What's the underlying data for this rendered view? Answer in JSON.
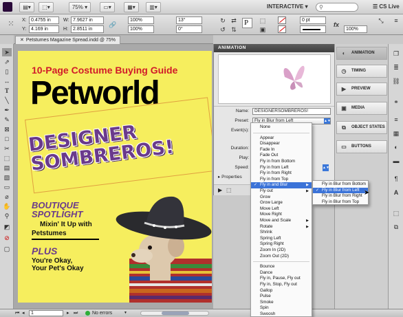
{
  "app": {
    "zoom": "75%",
    "workspace": "INTERACTIVE",
    "cs_live": "CS Live"
  },
  "control": {
    "x_label": "X:",
    "x_value": "0.4755 in",
    "y_label": "Y:",
    "y_value": "4.169 in",
    "w_label": "W:",
    "w_value": "7.9627 in",
    "h_label": "H:",
    "h_value": "2.8511 in",
    "scale_x": "100%",
    "scale_y": "100%",
    "rotate": "13°",
    "shear": "0°",
    "stroke_weight": "0 pt",
    "opacity": "100%",
    "fill_label": "P"
  },
  "document": {
    "tab_label": "Petstumes Magazine Spread.indd @ 75%",
    "kicker": "10-Page Costume Buying Guide",
    "title": "Petworld",
    "headline_line1": "DESIGNER",
    "headline_line2": "SOMBREROS!",
    "boutique_line1": "BOUTIQUE",
    "boutique_line2": "SPOTLIGHT",
    "boutique_sub1": "Mixin' It Up with",
    "boutique_sub2": "Petstumes",
    "plus": "PLUS",
    "plus_sub1": "You're Okay,",
    "plus_sub2": "Your Pet's Okay"
  },
  "animation_panel": {
    "title": "ANIMATION",
    "name_label": "Name:",
    "name_value": "DESIGNERSOMBREROS!",
    "preset_label": "Preset:",
    "preset_value": "Fly in Blur from Left",
    "events_label": "Event(s):",
    "duration_label": "Duration:",
    "play_label": "Play:",
    "speed_label": "Speed:",
    "properties_label": "Properties"
  },
  "preset_menu": {
    "items": [
      {
        "label": "None"
      },
      {
        "sep": true
      },
      {
        "label": "Appear"
      },
      {
        "label": "Disappear"
      },
      {
        "label": "Fade In"
      },
      {
        "label": "Fade Out"
      },
      {
        "label": "Fly in from Bottom"
      },
      {
        "label": "Fly in from Left"
      },
      {
        "label": "Fly in from Right"
      },
      {
        "label": "Fly in from Top"
      },
      {
        "label": "Fly in and Blur",
        "checked": true,
        "submenu": true,
        "highlighted": true
      },
      {
        "label": "Fly out",
        "submenu": true
      },
      {
        "label": "Grow"
      },
      {
        "label": "Grow Large"
      },
      {
        "label": "Move Left"
      },
      {
        "label": "Move Right"
      },
      {
        "label": "Move and Scale",
        "submenu": true
      },
      {
        "label": "Rotate",
        "submenu": true
      },
      {
        "label": "Shrink"
      },
      {
        "label": "Spring Left"
      },
      {
        "label": "Spring Right"
      },
      {
        "label": "Zoom In (2D)"
      },
      {
        "label": "Zoom Out (2D)"
      },
      {
        "sep": true
      },
      {
        "label": "Bounce"
      },
      {
        "label": "Dance"
      },
      {
        "label": "Fly in, Pause, Fly out"
      },
      {
        "label": "Fly in, Stop, Fly out"
      },
      {
        "label": "Gallop"
      },
      {
        "label": "Pulse"
      },
      {
        "label": "Smoke"
      },
      {
        "label": "Spin"
      },
      {
        "label": "Swoosh"
      },
      {
        "label": "Wave"
      }
    ]
  },
  "submenu": {
    "items": [
      {
        "label": "Fly in Blur from Bottom"
      },
      {
        "label": "Fly in Blur from Left",
        "checked": true,
        "highlighted": true
      },
      {
        "label": "Fly in Blur from Right"
      },
      {
        "label": "Fly in Blur from Top"
      }
    ]
  },
  "right_panels": [
    {
      "label": "ANIMATION",
      "icon": "animation-icon",
      "active": true
    },
    {
      "label": "TIMING",
      "icon": "timing-icon"
    },
    {
      "label": "PREVIEW",
      "icon": "preview-icon"
    },
    {
      "label": "MEDIA",
      "icon": "media-icon"
    },
    {
      "label": "OBJECT STATES",
      "icon": "object-states-icon"
    },
    {
      "label": "BUTTONS",
      "icon": "buttons-icon"
    }
  ],
  "status": {
    "page": "1",
    "errors": "No errors"
  },
  "colors": {
    "page_yellow": "#f6ee5e",
    "kicker_red": "#d11a2a",
    "headline_purple": "#6a3a8c",
    "menu_highlight": "#3b73d8",
    "panel_header": "#4a4a4a"
  }
}
